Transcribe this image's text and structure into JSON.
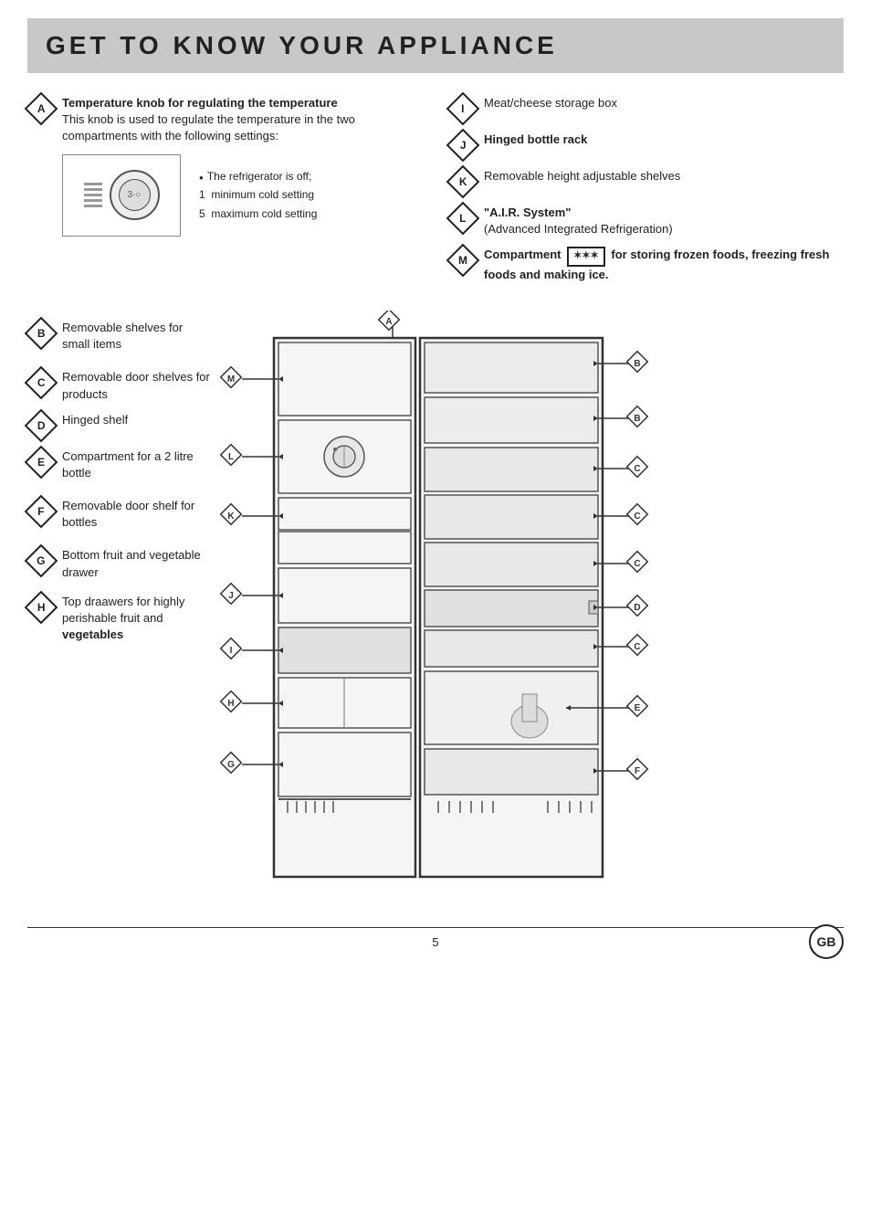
{
  "header": {
    "title": "GET TO KNOW YOUR APPLIANCE"
  },
  "items_left_top": [
    {
      "badge": "A",
      "type": "diamond",
      "bold": "Temperature knob for regulating the temperature",
      "normal": "This knob is used to regulate the temperature in the two compartments with the following settings:"
    }
  ],
  "temp_settings": [
    {
      "text": "The refrigerator is off;",
      "dot": true
    },
    {
      "text": "1  minimum cold setting",
      "dot": false
    },
    {
      "text": "5  maximum cold setting",
      "dot": false
    }
  ],
  "items_right_top": [
    {
      "badge": "I",
      "type": "diamond",
      "text": "Meat/cheese storage box"
    },
    {
      "badge": "J",
      "type": "diamond",
      "text": "Hinged bottle rack"
    },
    {
      "badge": "K",
      "type": "diamond",
      "text": "Removable height adjustable shelves"
    },
    {
      "badge": "L",
      "type": "diamond",
      "text": "\"A.I.R. System\""
    },
    {
      "badge": "L2",
      "type": "none",
      "text": "(Advanced Integrated Refrigeration)"
    },
    {
      "badge": "M",
      "type": "diamond",
      "text": "Compartment ✶✶✶ for storing frozen foods, freezing fresh foods and making ice."
    }
  ],
  "items_left_bottom": [
    {
      "badge": "B",
      "type": "diamond",
      "text": "Removable shelves for small items"
    },
    {
      "badge": "C",
      "type": "diamond",
      "text": "Removable door shelves for products"
    },
    {
      "badge": "D",
      "type": "diamond",
      "text": "Hinged shelf"
    },
    {
      "badge": "E",
      "type": "diamond",
      "text": "Compartment for a 2 litre bottle"
    },
    {
      "badge": "F",
      "type": "diamond",
      "text": "Removable door shelf for bottles"
    },
    {
      "badge": "G",
      "type": "diamond",
      "text": "Bottom fruit and vegetable drawer"
    },
    {
      "badge": "H",
      "type": "diamond",
      "text": "Top draawers for highly perishable fruit and vegetables"
    }
  ],
  "footer": {
    "page": "5",
    "country": "GB"
  }
}
